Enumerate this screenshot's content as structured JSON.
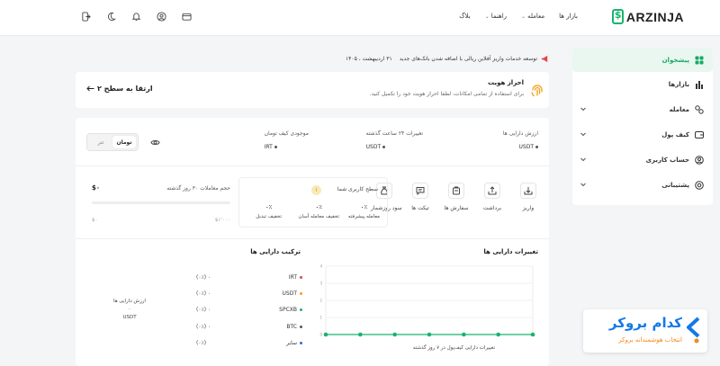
{
  "brand": {
    "name": "ARZINJA",
    "color": "#18b46e"
  },
  "nav": {
    "items": [
      {
        "label": "بازار ها",
        "has_dropdown": false
      },
      {
        "label": "معامله",
        "has_dropdown": true
      },
      {
        "label": "راهنما",
        "has_dropdown": true
      },
      {
        "label": "بلاگ",
        "has_dropdown": false
      }
    ]
  },
  "top_icons": [
    "wallet-icon",
    "user-icon",
    "bell-icon",
    "moon-icon",
    "logout-icon"
  ],
  "sidebar": {
    "items": [
      {
        "label": "پیشخوان",
        "icon": "dashboard-icon",
        "active": true,
        "expandable": false
      },
      {
        "label": "بازارها",
        "icon": "chart-bars-icon",
        "active": false,
        "expandable": false
      },
      {
        "label": "معامله",
        "icon": "exchange-icon",
        "active": false,
        "expandable": true
      },
      {
        "label": "کیف پول",
        "icon": "wallet-icon",
        "active": false,
        "expandable": true
      },
      {
        "label": "حساب کاربری",
        "icon": "user-icon",
        "active": false,
        "expandable": true
      },
      {
        "label": "پشتیبانی",
        "icon": "support-icon",
        "active": false,
        "expandable": true
      }
    ]
  },
  "notice": {
    "text": "توسعه خدمات واریز آفلاین ریالی با اضافه شدن بانک‌های جدید",
    "date": "۳۱ اردیبهشت ، ۱۴۰۵"
  },
  "kyc": {
    "title": "احراز هویت",
    "subtitle": "برای استفاده از تمامی امکانات، لطفا احراز هویت خود را تکمیل کنید.",
    "link": "ارتقا به سطح ۲"
  },
  "stats": {
    "asset_value": {
      "label": "ارزش دارایی ها",
      "value": "USDT"
    },
    "change_24h": {
      "label": "تغییرات ۲۴ ساعت گذشته",
      "value": "USDT"
    },
    "toman_balance": {
      "label": "موجودی کیف تومان",
      "value": "IRT"
    }
  },
  "currency_toggle": {
    "options": [
      "تومان",
      "تتر"
    ],
    "selected": "تومان"
  },
  "actions": [
    {
      "label": "واریز",
      "icon": "deposit-icon"
    },
    {
      "label": "برداشت",
      "icon": "withdraw-icon"
    },
    {
      "label": "سفارش ها",
      "icon": "orders-icon"
    },
    {
      "label": "تیکت ها",
      "icon": "ticket-icon"
    },
    {
      "label": "سود روزشمار",
      "icon": "money-bag-icon"
    }
  ],
  "user_level": {
    "title": "سطح کاربری شما",
    "badge": "۱",
    "columns": [
      {
        "value": "۰٪",
        "label": "معامله پیشرفته"
      },
      {
        "value": "۰٪",
        "label": "تخفیف معامله آسان"
      },
      {
        "value": "۰٪",
        "label": "تخفیف تبدیل"
      }
    ]
  },
  "trade_volume": {
    "title": "حجم معاملات ۳۰ روز گذشته",
    "value": "$۰",
    "min": "$۰",
    "max": "$۱٬۰۰۰"
  },
  "asset_changes": {
    "title": "تغییرات دارایی ها",
    "caption": "تغییرات دارایی کیف‌پول در ۷ روز گذشته"
  },
  "asset_composition": {
    "title": "ترکیب دارایی ها",
    "items": [
      {
        "name": "IRT",
        "pct": "(۰٪) ۰",
        "color": "#e04646"
      },
      {
        "name": "USDT",
        "pct": "(۰٪) ۰",
        "color": "#f2a114"
      },
      {
        "name": "SPCXB",
        "pct": "(۰٪) ۰",
        "color": "#18b46e"
      },
      {
        "name": "BTC",
        "pct": "(۰٪) ۰",
        "color": "#555555"
      },
      {
        "name": "سایر",
        "pct": "(۰٪)",
        "color": "#3a66d8"
      }
    ],
    "total_label": "ارزش دارایی ها",
    "total_value": "۰",
    "total_unit": "USDT"
  },
  "chart_data": {
    "type": "line",
    "title": "تغییرات دارایی ها",
    "xlabel": "تغییرات دارایی کیف‌پول در ۷ روز گذشته",
    "ylabel": "",
    "x": [
      1,
      2,
      3,
      4,
      5,
      6,
      7
    ],
    "series": [
      {
        "values": [
          0,
          0,
          0,
          0,
          0,
          0,
          0
        ]
      }
    ],
    "ylim": [
      0,
      4
    ],
    "yticks": [
      0,
      1,
      2,
      3,
      4
    ],
    "grid": true,
    "color": "#18b46e"
  },
  "promo": {
    "title": "کدام بروکر",
    "subtitle": "انتخاب هوشمندانه بروکر"
  }
}
